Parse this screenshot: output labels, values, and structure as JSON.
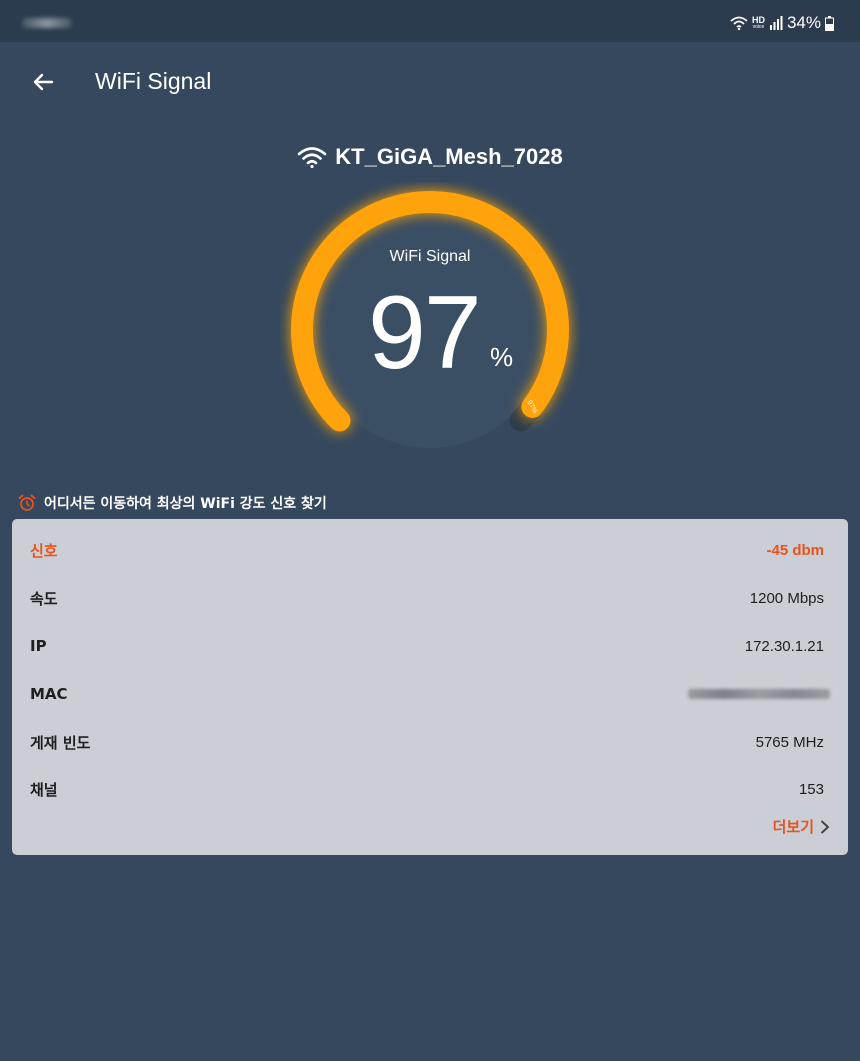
{
  "status_bar": {
    "hd_label": "HD",
    "hd_sub": "voice",
    "battery": "34%"
  },
  "app_bar": {
    "title": "WiFi Signal"
  },
  "network": {
    "ssid": "KT_GiGA_Mesh_7028"
  },
  "gauge": {
    "label": "WiFi Signal",
    "value": "97",
    "unit": "%",
    "fraction": 0.97,
    "color": "#FFA310"
  },
  "hint": {
    "text": "어디서든 이동하여 최상의 WiFi 강도 신호 찾기"
  },
  "info": {
    "rows": [
      {
        "label": "신호",
        "value": "-45 dbm"
      },
      {
        "label": "속도",
        "value": "1200 Mbps"
      },
      {
        "label": "IP",
        "value": "172.30.1.21"
      },
      {
        "label": "MAC",
        "value": ""
      },
      {
        "label": "게재 빈도",
        "value": "5765 MHz"
      },
      {
        "label": "채널",
        "value": "153"
      }
    ],
    "more_label": "더보기"
  },
  "colors": {
    "background": "#35485D",
    "accent": "#E8531C",
    "gauge": "#FFA310",
    "card": "#CBCED4"
  }
}
